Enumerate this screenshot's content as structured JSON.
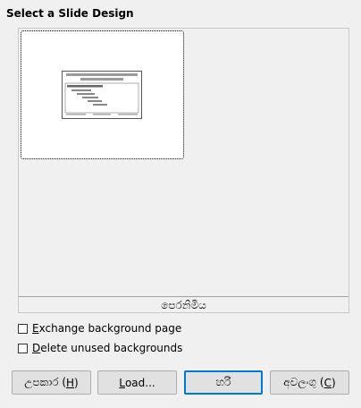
{
  "dialog": {
    "heading": "Select a Slide Design"
  },
  "gallery": {
    "caption": "පෙරනිමිය",
    "thumbnail_lines": [
      "සිංහල ශ්‍රේණිගත කිරීමේ ව්‍යුහය",
      "ස්ලයිඩ් මාස්ටර් පෙළ ආකෘතිය",
      "• පළමු මට්ටම",
      "දෙවන මට්ටම",
      "තෙවන මට්ටම",
      "සිව්වන මට්ටම"
    ]
  },
  "options": {
    "exchange_pre": "",
    "exchange_mnemonic": "E",
    "exchange_post": "xchange background page",
    "delete_pre": "",
    "delete_mnemonic": "D",
    "delete_post": "elete unused backgrounds"
  },
  "buttons": {
    "help_pre": "උපකාර (",
    "help_mnemonic": "H",
    "help_post": ")",
    "load_pre": "",
    "load_mnemonic": "L",
    "load_post": "oad...",
    "ok_label": "හරි",
    "cancel_pre": "අවලංගු (",
    "cancel_mnemonic": "C",
    "cancel_post": ")"
  }
}
